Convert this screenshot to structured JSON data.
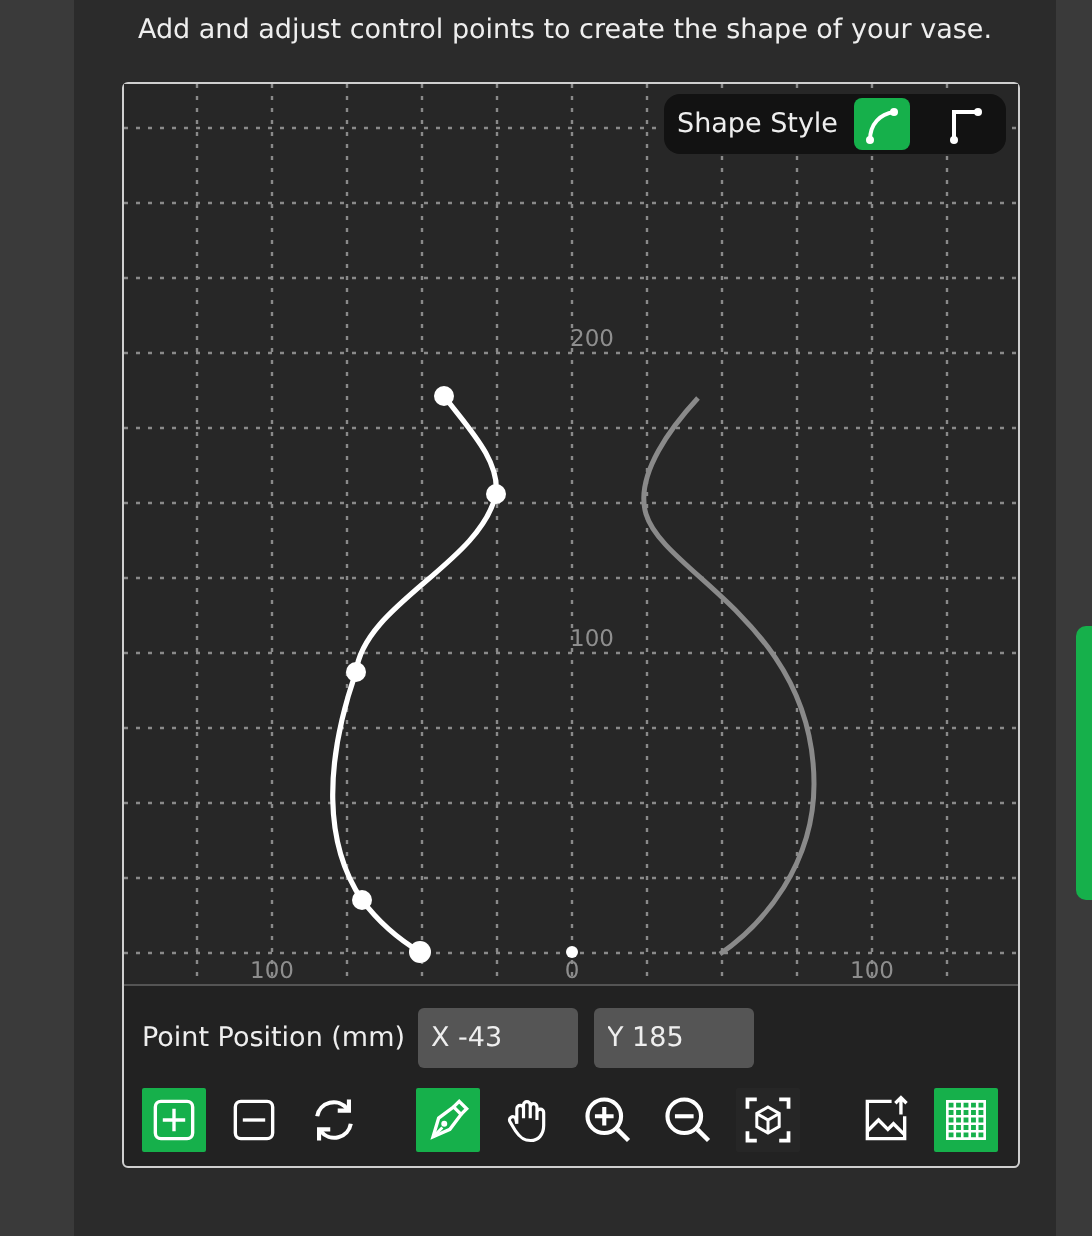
{
  "instruction": "Add and adjust control points to create the shape of your vase.",
  "shape_style": {
    "label": "Shape Style",
    "options": [
      {
        "kind": "curve",
        "selected": true
      },
      {
        "kind": "corner",
        "selected": false
      }
    ]
  },
  "canvas": {
    "axis_labels": [
      {
        "kind": "y",
        "text": "200"
      },
      {
        "kind": "y",
        "text": "100"
      },
      {
        "kind": "x",
        "text": "100"
      },
      {
        "kind": "x",
        "text": "0"
      },
      {
        "kind": "x",
        "text": "100"
      }
    ]
  },
  "point_position": {
    "label": "Point Position (mm)",
    "x": "X -43",
    "y": "Y 185"
  },
  "toolbar": [
    {
      "kind": "add",
      "selected": true
    },
    {
      "kind": "remove",
      "selected": false
    },
    {
      "kind": "reset",
      "selected": false
    },
    {
      "kind": "pen",
      "selected": true
    },
    {
      "kind": "pan",
      "selected": false
    },
    {
      "kind": "zoom_in",
      "selected": false
    },
    {
      "kind": "zoom_out",
      "selected": false
    },
    {
      "kind": "fit",
      "selected": false
    },
    {
      "kind": "image",
      "selected": false
    },
    {
      "kind": "grid",
      "selected": true
    }
  ]
}
